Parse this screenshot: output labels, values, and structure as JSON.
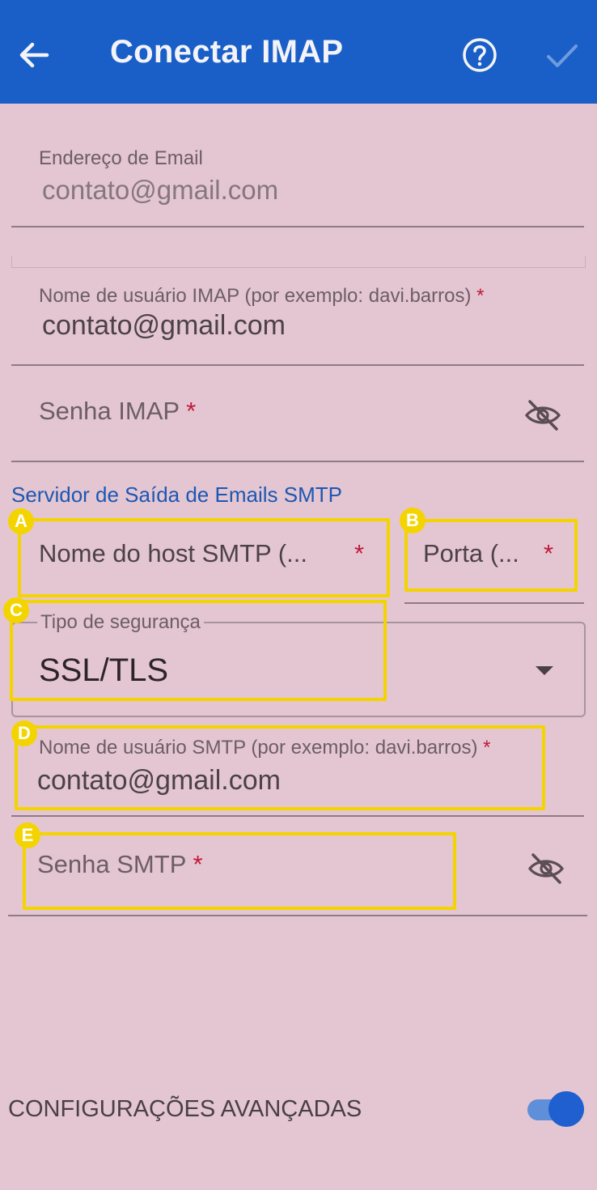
{
  "header": {
    "title": "Conectar IMAP"
  },
  "form": {
    "email": {
      "label": "Endereço de Email",
      "value": "contato@gmail.com"
    },
    "imap_user": {
      "label": "Nome de usuário IMAP (por exemplo: davi.barros)",
      "required_mark": "*",
      "value": "contato@gmail.com"
    },
    "imap_password": {
      "label": "Senha IMAP",
      "required_mark": "*"
    },
    "smtp_section_title": "Servidor de Saída de Emails SMTP",
    "smtp_host": {
      "label": "Nome do host SMTP (...",
      "required_mark": "*",
      "badge": "A"
    },
    "smtp_port": {
      "label": "Porta (...",
      "required_mark": "*",
      "badge": "B"
    },
    "security": {
      "label": "Tipo de segurança",
      "value": "SSL/TLS",
      "badge": "C"
    },
    "smtp_user": {
      "label": "Nome de usuário SMTP (por exemplo: davi.barros)",
      "required_mark": "*",
      "value": "contato@gmail.com",
      "badge": "D"
    },
    "smtp_password": {
      "label": "Senha SMTP",
      "required_mark": "*",
      "badge": "E"
    }
  },
  "advanced": {
    "label": "CONFIGURAÇÕES AVANÇADAS",
    "toggle_on": true
  },
  "colors": {
    "header_blue": "#1a5fc7",
    "highlight_yellow": "#f4d400",
    "required_red": "#c0193b"
  }
}
